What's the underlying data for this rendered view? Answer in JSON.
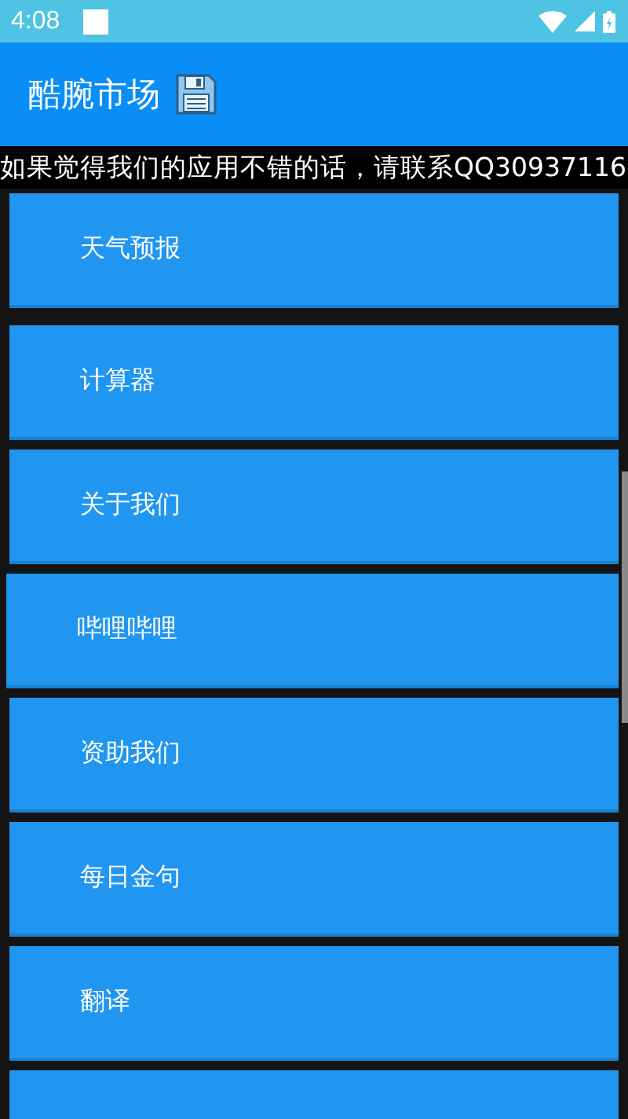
{
  "status_bar": {
    "time": "4:08"
  },
  "app_bar": {
    "title": "酷腕市场"
  },
  "marquee": {
    "text": "如果觉得我们的应用不错的话，请联系QQ30937116"
  },
  "menu_items": [
    {
      "kind": "text",
      "label": "天气预报"
    },
    {
      "kind": "text",
      "label": "计算器"
    },
    {
      "kind": "text",
      "label": "关于我们"
    },
    {
      "kind": "text",
      "label": "哔哩哔哩"
    },
    {
      "kind": "text",
      "label": "资助我们"
    },
    {
      "kind": "text",
      "label": "每日金句"
    },
    {
      "kind": "text",
      "label": "翻译"
    },
    {
      "kind": "blank"
    }
  ]
}
